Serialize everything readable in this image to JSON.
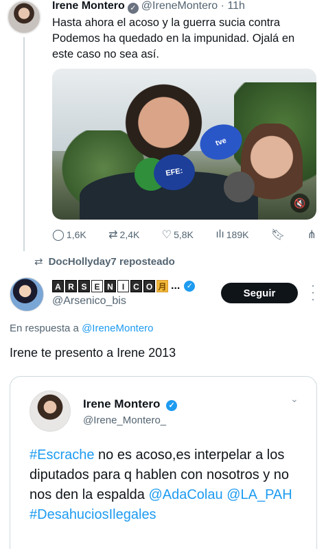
{
  "tweet": {
    "author_name": "Irene Montero",
    "author_handle": "@IreneMontero",
    "separator": "·",
    "time": "11h",
    "text": "Hasta ahora el acoso y la guerra sucia contra Podemos ha quedado en la impunidad. Ojalá en este caso no sea así.",
    "media": {
      "mic_tve": "tve",
      "mic_efe": "EFE:"
    },
    "stats": {
      "replies": "1,6K",
      "reposts": "2,4K",
      "likes": "5,8K",
      "views": "189K"
    }
  },
  "repost_banner": {
    "label": "DocHollyday7 reposteado"
  },
  "reply": {
    "author_name_letters": [
      "A",
      "R",
      "S",
      "E",
      "N",
      "I",
      "C",
      "O"
    ],
    "author_name_emoji": "月",
    "author_name_ellipsis": "...",
    "author_handle": "@Arsenico_bis",
    "follow_label": "Seguir",
    "reply_prefix": "En respuesta a",
    "reply_mention": "@IreneMontero",
    "text": "Irene te presento a Irene 2013"
  },
  "quoted": {
    "author_name": "Irene Montero",
    "author_handle": "@Irene_Montero_",
    "parts": {
      "hashtag1": "#Escrache",
      "t1": " no es acoso,es interpelar a los diputados para q hablen con nosotros y no nos den la espalda ",
      "m1": "@AdaColau",
      "sp": " ",
      "m2": "@LA_PAH",
      "hashtag2": "#DesahuciosIlegales"
    }
  },
  "colors": {
    "accent": "#1d9bf0",
    "text": "#0f1419",
    "muted": "#536471",
    "follow_bg": "#0f1419"
  }
}
